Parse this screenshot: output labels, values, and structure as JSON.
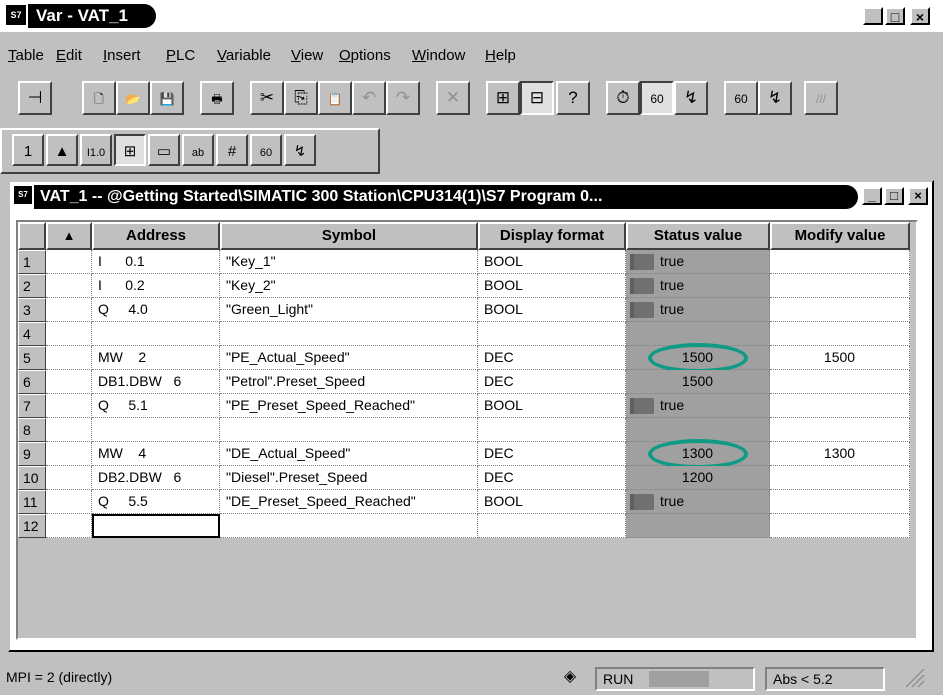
{
  "window": {
    "title": "Var - VAT_1",
    "app_icon": "S7",
    "controls": [
      "_",
      "□",
      "×"
    ]
  },
  "menu": [
    {
      "u": "T",
      "rest": "able"
    },
    {
      "u": "E",
      "rest": "dit"
    },
    {
      "u": "I",
      "rest": "nsert"
    },
    {
      "u": "P",
      "rest": "LC"
    },
    {
      "u": "V",
      "rest": "ariable"
    },
    {
      "u": "V",
      "rest": "iew"
    },
    {
      "u": "O",
      "rest": "ptions"
    },
    {
      "u": "W",
      "rest": "indow"
    },
    {
      "u": "H",
      "rest": "elp"
    }
  ],
  "toolbar1": [
    {
      "icon": "pin-icon",
      "glyph": "⊣"
    },
    {
      "icon": "new-icon",
      "glyph": "🗋"
    },
    {
      "icon": "open-icon",
      "glyph": "📂"
    },
    {
      "icon": "save-icon",
      "glyph": "💾"
    },
    {
      "icon": "print-icon",
      "glyph": "🖶"
    },
    {
      "icon": "cut-icon",
      "glyph": "✂"
    },
    {
      "icon": "copy-icon",
      "glyph": "⎘"
    },
    {
      "icon": "paste-icon",
      "glyph": "📋"
    },
    {
      "icon": "undo-icon",
      "glyph": "↶"
    },
    {
      "icon": "redo-icon",
      "glyph": "↷"
    },
    {
      "icon": "delete-icon",
      "glyph": "✕"
    },
    {
      "icon": "offline-icon",
      "glyph": "⊞"
    },
    {
      "icon": "online-icon",
      "glyph": "⊟"
    },
    {
      "icon": "help-icon",
      "glyph": "?"
    },
    {
      "icon": "trigger-icon",
      "glyph": "⏱"
    },
    {
      "icon": "monitor-icon",
      "glyph": "60"
    },
    {
      "icon": "modify-icon",
      "glyph": "↯"
    },
    {
      "icon": "monitor-once-icon",
      "glyph": "60"
    },
    {
      "icon": "modify-once-icon",
      "glyph": "↯"
    },
    {
      "icon": "force-icon",
      "glyph": "///"
    }
  ],
  "toolbar2": [
    {
      "icon": "address-col-icon",
      "glyph": "1"
    },
    {
      "icon": "symbol-col-icon",
      "glyph": "▲"
    },
    {
      "icon": "symbol-comment-icon",
      "glyph": "I1.0"
    },
    {
      "icon": "format-col-icon",
      "glyph": "⊞"
    },
    {
      "icon": "status-col-icon",
      "glyph": "▭"
    },
    {
      "icon": "modify-col-icon",
      "glyph": "ab"
    },
    {
      "icon": "numeric-col-icon",
      "glyph": "#"
    },
    {
      "icon": "monitor-col-icon",
      "glyph": "60"
    },
    {
      "icon": "modify-trigger-icon",
      "glyph": "↯"
    }
  ],
  "vat": {
    "title": "VAT_1 -- @Getting Started\\SIMATIC 300 Station\\CPU314(1)\\S7 Program  0...",
    "icon": "S7",
    "controls": [
      "_",
      "□",
      "×"
    ],
    "columns": [
      "Address",
      "Symbol",
      "Display format",
      "Status value",
      "Modify value"
    ],
    "rows": [
      {
        "n": "1",
        "addr": "I      0.1",
        "sym": "\"Key_1\"",
        "fmt": "BOOL",
        "status": "true",
        "ind": true,
        "mod": ""
      },
      {
        "n": "2",
        "addr": "I      0.2",
        "sym": "\"Key_2\"",
        "fmt": "BOOL",
        "status": "true",
        "ind": true,
        "mod": ""
      },
      {
        "n": "3",
        "addr": "Q     4.0",
        "sym": "\"Green_Light\"",
        "fmt": "BOOL",
        "status": "true",
        "ind": true,
        "mod": ""
      },
      {
        "n": "4",
        "addr": "",
        "sym": "",
        "fmt": "",
        "status": "",
        "ind": false,
        "mod": ""
      },
      {
        "n": "5",
        "addr": "MW    2",
        "sym": "\"PE_Actual_Speed\"",
        "fmt": "DEC",
        "status": "1500",
        "ind": false,
        "mod": "1500",
        "circle": true
      },
      {
        "n": "6",
        "addr": "DB1.DBW   6",
        "sym": "\"Petrol\".Preset_Speed",
        "fmt": "DEC",
        "status": "1500",
        "ind": false,
        "mod": ""
      },
      {
        "n": "7",
        "addr": "Q     5.1",
        "sym": "\"PE_Preset_Speed_Reached\"",
        "fmt": "BOOL",
        "status": "true",
        "ind": true,
        "mod": ""
      },
      {
        "n": "8",
        "addr": "",
        "sym": "",
        "fmt": "",
        "status": "",
        "ind": false,
        "mod": ""
      },
      {
        "n": "9",
        "addr": "MW    4",
        "sym": "\"DE_Actual_Speed\"",
        "fmt": "DEC",
        "status": "1300",
        "ind": false,
        "mod": "1300",
        "circle": true
      },
      {
        "n": "10",
        "addr": "DB2.DBW   6",
        "sym": "\"Diesel\".Preset_Speed",
        "fmt": "DEC",
        "status": "1200",
        "ind": false,
        "mod": ""
      },
      {
        "n": "11",
        "addr": "Q     5.5",
        "sym": "\"DE_Preset_Speed_Reached\"",
        "fmt": "BOOL",
        "status": "true",
        "ind": true,
        "mod": ""
      },
      {
        "n": "12",
        "addr": "",
        "sym": "",
        "fmt": "",
        "status": "",
        "ind": false,
        "mod": "",
        "selected": true
      }
    ]
  },
  "statusbar": {
    "connection": "MPI =  2 (directly)",
    "cpu_icon": "◈",
    "mode": "RUN",
    "abs": "Abs < 5.2"
  },
  "colors": {
    "highlight": "#0e9a85",
    "status_col": "#a0a0a0"
  }
}
